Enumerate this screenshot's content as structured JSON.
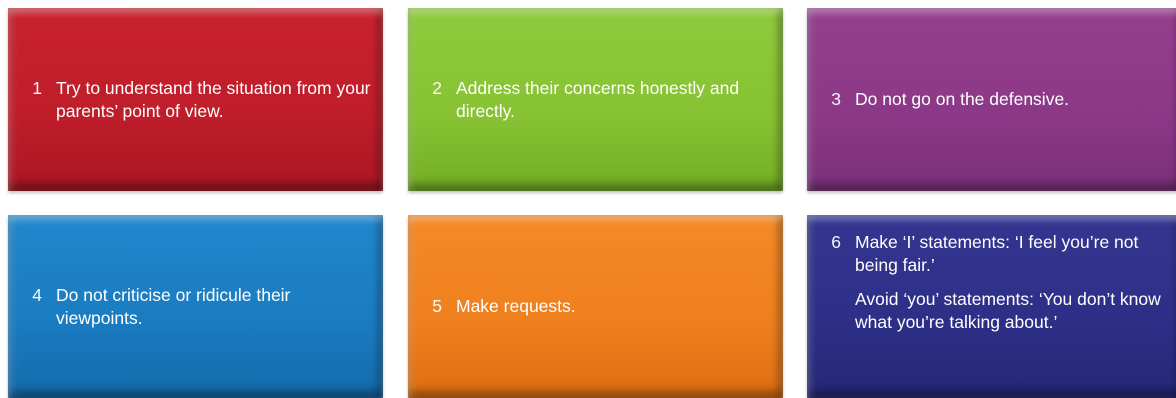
{
  "tiles": [
    {
      "number": "1",
      "text": "Try to understand the situation from your parents’ point of view.",
      "color": "#c01e2b"
    },
    {
      "number": "2",
      "text": "Address their concerns honestly and directly.",
      "color": "#86c232"
    },
    {
      "number": "3",
      "text": "Do not go on the defensive.",
      "color": "#8b3887"
    },
    {
      "number": "4",
      "text": "Do not criticise or ridicule their viewpoints.",
      "color": "#1a7bc0"
    },
    {
      "number": "5",
      "text": "Make requests.",
      "color": "#ee7f1d"
    },
    {
      "number": "6",
      "text": "Make ‘I’ statements: ‘I feel you’re not being fair.’",
      "extra": "Avoid ‘you’ statements: ‘You don’t know what you’re talking about.’",
      "color": "#2d2f87"
    }
  ]
}
